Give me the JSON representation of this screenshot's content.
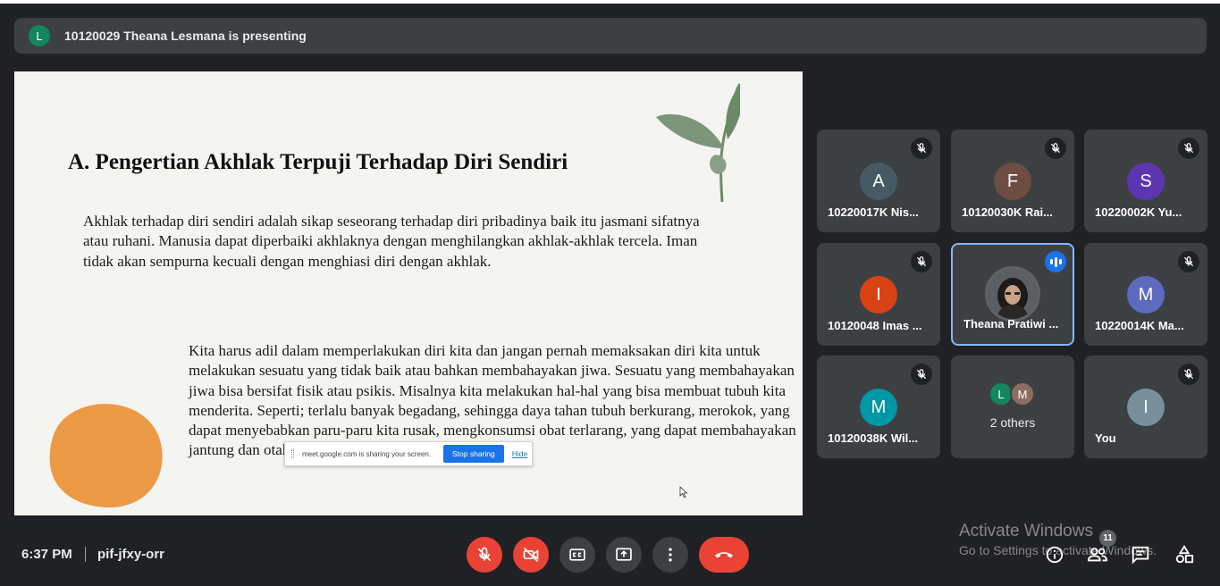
{
  "presenting_bar": {
    "avatar_letter": "L",
    "text": "10120029 Theana Lesmana is presenting"
  },
  "slide": {
    "title": "A. Pengertian Akhlak Terpuji Terhadap Diri Sendiri",
    "paragraph1": "Akhlak terhadap diri sendiri adalah sikap seseorang terhadap diri pribadinya baik itu jasmani sifatnya atau ruhani. Manusia dapat diperbaiki akhlaknya dengan menghilangkan akhlak-akhlak tercela. Iman tidak akan sempurna kecuali dengan menghiasi diri dengan akhlak.",
    "paragraph2": "Kita harus adil dalam memperlakukan diri kita dan jangan pernah memaksakan diri kita untuk melakukan sesuatu yang tidak baik atau bahkan membahayakan jiwa. Sesuatu yang membahayakan jiwa bisa bersifat fisik atau psikis. Misalnya kita melakukan hal-hal yang bisa membuat tubuh kita menderita. Seperti; terlalu banyak begadang, sehingga daya tahan tubuh berkurang, merokok, yang dapat menyebabkan paru-paru kita rusak, mengkonsumsi obat terlarang, yang dapat membahayakan jantung dan otak kita.",
    "share_notice": {
      "text": "meet.google.com is sharing your screen.",
      "stop_label": "Stop sharing",
      "hide_label": "Hide"
    }
  },
  "participants": [
    {
      "letter": "A",
      "name": "10220017K Nis...",
      "color": "#455a64",
      "muted": true
    },
    {
      "letter": "F",
      "name": "10120030K Rai...",
      "color": "#6d4c41",
      "muted": true
    },
    {
      "letter": "S",
      "name": "10220002K Yu...",
      "color": "#5e35b1",
      "muted": true
    },
    {
      "letter": "I",
      "name": "10120048 Imas ...",
      "color": "#d84315",
      "muted": true
    },
    {
      "letter": "",
      "name": "Theana Pratiwi ...",
      "color": "#4a4d51",
      "muted": false,
      "speaking": true
    },
    {
      "letter": "M",
      "name": "10220014K Ma...",
      "color": "#5c6bc0",
      "muted": true
    },
    {
      "letter": "M",
      "name": "10120038K Wil...",
      "color": "#0097a7",
      "muted": true
    },
    {
      "letter": "",
      "name": "2 others",
      "color": "",
      "muted": false,
      "others": [
        {
          "letter": "L",
          "color": "#12865d"
        },
        {
          "letter": "M",
          "color": "#8d6e63"
        }
      ]
    },
    {
      "letter": "I",
      "name": "You",
      "color": "#78909c",
      "muted": true
    }
  ],
  "bottom_bar": {
    "time": "6:37 PM",
    "meeting_code": "pif-jfxy-orr",
    "participant_count": "11"
  },
  "watermark": {
    "title": "Activate Windows",
    "subtitle": "Go to Settings to activate Windows."
  },
  "colors": {
    "background": "#202124",
    "tile": "#3c4043",
    "danger": "#ea4335",
    "accent": "#1a73e8",
    "slide_blob": "#ed9a47"
  },
  "icons": {
    "mic": "mic-off-icon",
    "camera": "videocam-off-icon",
    "captions": "closed-caption-icon",
    "present": "present-screen-icon",
    "more": "more-vert-icon",
    "hangup": "call-end-icon",
    "info": "info-icon",
    "people": "people-icon",
    "chat": "chat-icon",
    "activities": "activities-icon"
  }
}
